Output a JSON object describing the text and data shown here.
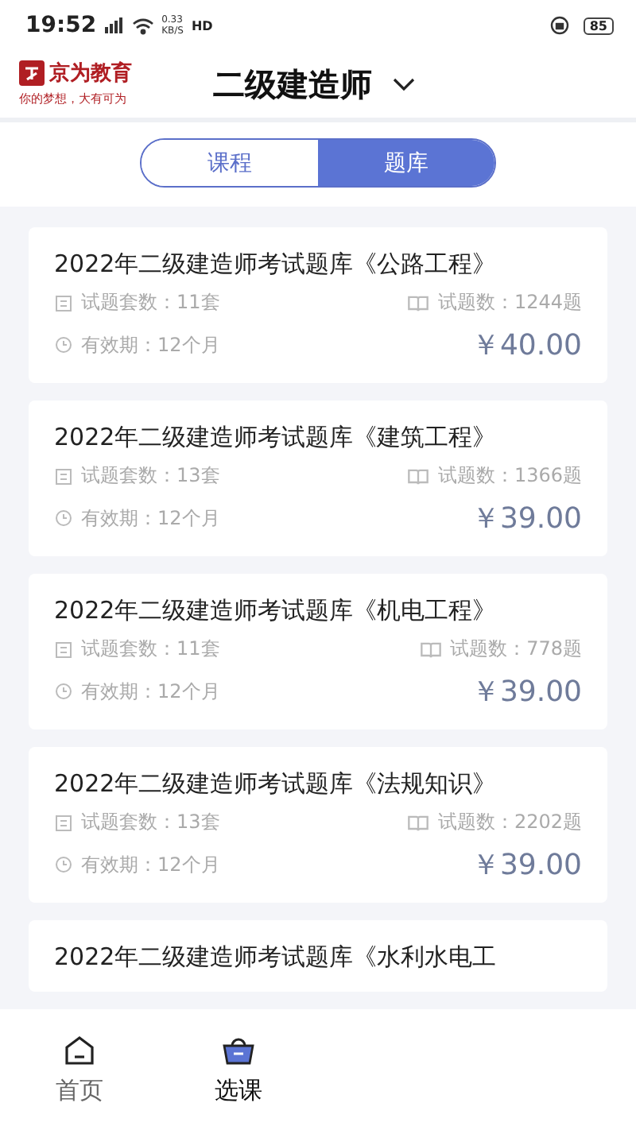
{
  "status_bar": {
    "time": "19:52",
    "speed_value": "0.33",
    "speed_unit": "KB/S",
    "network": "HD",
    "battery": "85"
  },
  "header": {
    "brand": "京为教育",
    "slogan": "你的梦想，大有可为",
    "title": "二级建造师"
  },
  "tabs": [
    {
      "label": "课程",
      "selected": false
    },
    {
      "label": "题库",
      "selected": true
    }
  ],
  "items": [
    {
      "title": "2022年二级建造师考试题库《公路工程》",
      "sets": "试题套数：11套",
      "questions": "试题数：1244题",
      "validity": "有效期：12个月",
      "price": "￥40.00"
    },
    {
      "title": "2022年二级建造师考试题库《建筑工程》",
      "sets": "试题套数：13套",
      "questions": "试题数：1366题",
      "validity": "有效期：12个月",
      "price": "￥39.00"
    },
    {
      "title": "2022年二级建造师考试题库《机电工程》",
      "sets": "试题套数：11套",
      "questions": "试题数：778题",
      "validity": "有效期：12个月",
      "price": "￥39.00"
    },
    {
      "title": "2022年二级建造师考试题库《法规知识》",
      "sets": "试题套数：13套",
      "questions": "试题数：2202题",
      "validity": "有效期：12个月",
      "price": "￥39.00"
    },
    {
      "title": "2022年二级建造师考试题库《水利水电工"
    }
  ],
  "nav": [
    {
      "label": "首页",
      "kind": "home",
      "selected": false
    },
    {
      "label": "选课",
      "kind": "basket",
      "selected": true
    }
  ]
}
